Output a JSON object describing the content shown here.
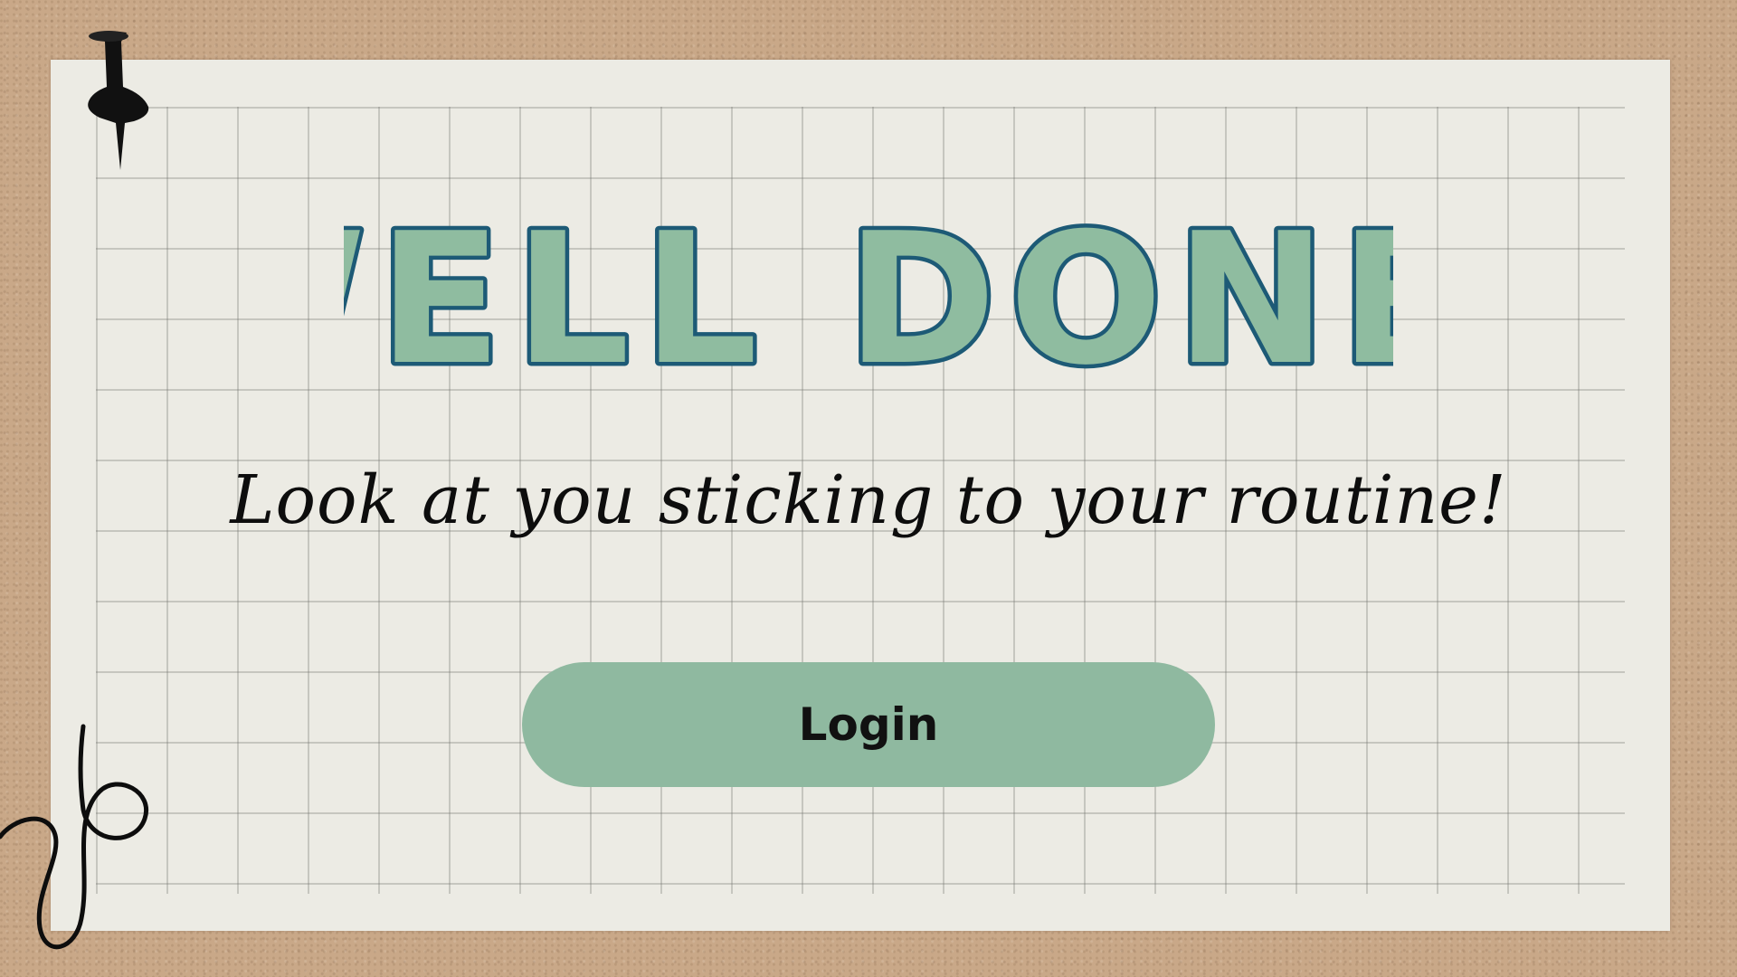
{
  "headline": {
    "text": "WELL DONE!"
  },
  "message": {
    "text": "Look at you sticking to your routine!"
  },
  "login_button": {
    "label": "Login"
  },
  "icons": {
    "pushpin": "pushpin-icon",
    "swirl": "swirl-doodle-icon"
  },
  "colors": {
    "background": "#c9a888",
    "paper": "#ecebe4",
    "headline_fill": "#8fbca0",
    "headline_outline": "#1d5a76",
    "button": "#8fb9a0",
    "text": "#0d0d0d"
  }
}
